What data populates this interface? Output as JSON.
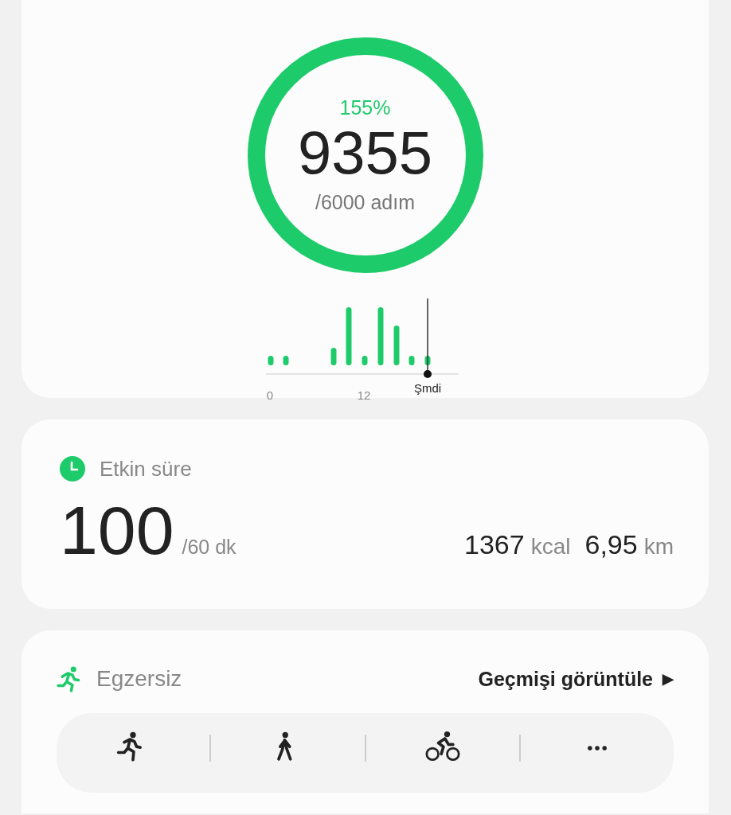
{
  "steps": {
    "percent": "155%",
    "count": "9355",
    "goal": "/6000 adım",
    "level": 1,
    "chart": {
      "x_labels": [
        "0",
        "12"
      ],
      "now_label": "Şmdi"
    }
  },
  "active_time": {
    "title": "Etkin süre",
    "value": "100",
    "goal": "/60 dk",
    "stats": [
      {
        "value": "1367",
        "unit": "kcal"
      },
      {
        "value": "6,95",
        "unit": "km"
      }
    ]
  },
  "exercise": {
    "title": "Egzersiz",
    "link": "Geçmişi görüntüle",
    "link_icon": "▶",
    "activities": [
      {
        "kind": "run"
      },
      {
        "kind": "walk"
      },
      {
        "kind": "cycle"
      },
      {
        "kind": "more"
      }
    ]
  }
}
